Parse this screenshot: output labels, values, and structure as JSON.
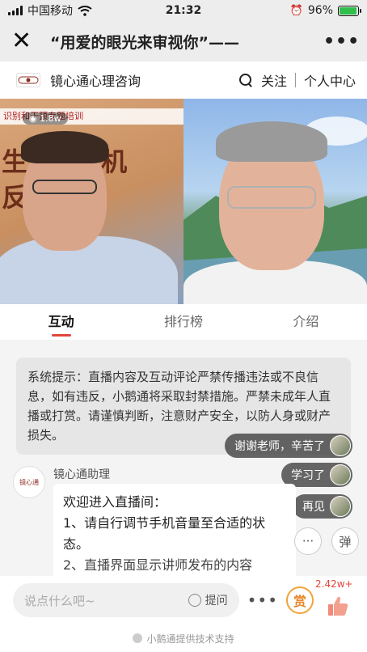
{
  "status_bar": {
    "carrier": "中国移动",
    "time": "21:32",
    "battery": "96%",
    "battery_level": 0.96
  },
  "nav": {
    "close_label": "✕",
    "title": "“用爱的眼光来审视你”——",
    "more_label": "•••"
  },
  "channel": {
    "name": "镜心通心理咨询",
    "follow_label": "关注",
    "profile_label": "个人中心"
  },
  "video": {
    "banner_text": "识别和干预专题培训",
    "viewer_count": "1.8w",
    "background_words": [
      "生 理危机",
      "反"
    ]
  },
  "tabs": [
    {
      "label": "互动",
      "active": true
    },
    {
      "label": "排行榜",
      "active": false
    },
    {
      "label": "介绍",
      "active": false
    }
  ],
  "system_notice": "系统提示：直播内容及互动评论严禁传播违法或不良信息，如有违反，小鹅通将采取封禁措施。严禁未成年人直播或打赏。请谨慎判断，注意财产安全，以防人身或财产损失。",
  "floating_comments": [
    {
      "text": "谢谢老师，辛苦了"
    },
    {
      "text": "学习了"
    },
    {
      "text": "再见"
    }
  ],
  "assistant_message": {
    "sender": "镜心通助理",
    "avatar_text": "镜心通",
    "lines": [
      "欢迎进入直播间：",
      "1、请自行调节手机音量至合适的状态。",
      "2、直播界面显示讲师发布的内容"
    ]
  },
  "side_buttons": {
    "chat_label": "···",
    "danmaku_label": "弹"
  },
  "bottom_bar": {
    "input_placeholder": "说点什么吧~",
    "ask_label": "提问",
    "more_label": "•••",
    "reward_label": "赏",
    "like_count": "2.42w+"
  },
  "footer": {
    "text": "小鹅通提供技术支持"
  }
}
